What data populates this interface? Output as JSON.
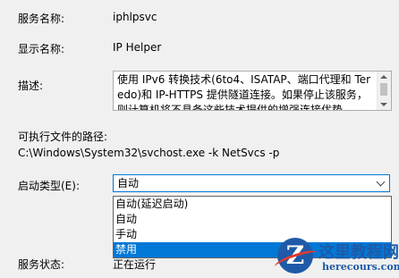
{
  "service": {
    "name_label": "服务名称:",
    "name_value": "iphlpsvc",
    "display_label": "显示名称:",
    "display_value": "IP Helper",
    "desc_label": "描述:",
    "desc_value": "使用 IPv6 转换技术(6to4、ISATAP、端口代理和 Teredo)和 IP-HTTPS 提供隧道连接。如果停止该服务，则计算机将不具备这些技术提供的增强连接优势",
    "path_label": "可执行文件的路径:",
    "path_value": "C:\\Windows\\System32\\svchost.exe -k NetSvcs -p",
    "startup_label": "启动类型(E):",
    "startup_selected": "自动",
    "startup_options": [
      "自动(延迟启动)",
      "自动",
      "手动",
      "禁用"
    ],
    "startup_highlighted_index": 3,
    "status_label": "服务状态:",
    "status_value": "正在运行"
  },
  "watermark": {
    "badge": "Z",
    "title": "这里教程网",
    "url": "herecours.com"
  },
  "colors": {
    "window_bg": "#f0f0f0",
    "accent": "#0078d7",
    "watermark_blue": "#1e5aa8",
    "watermark_red": "#e13a2f"
  }
}
